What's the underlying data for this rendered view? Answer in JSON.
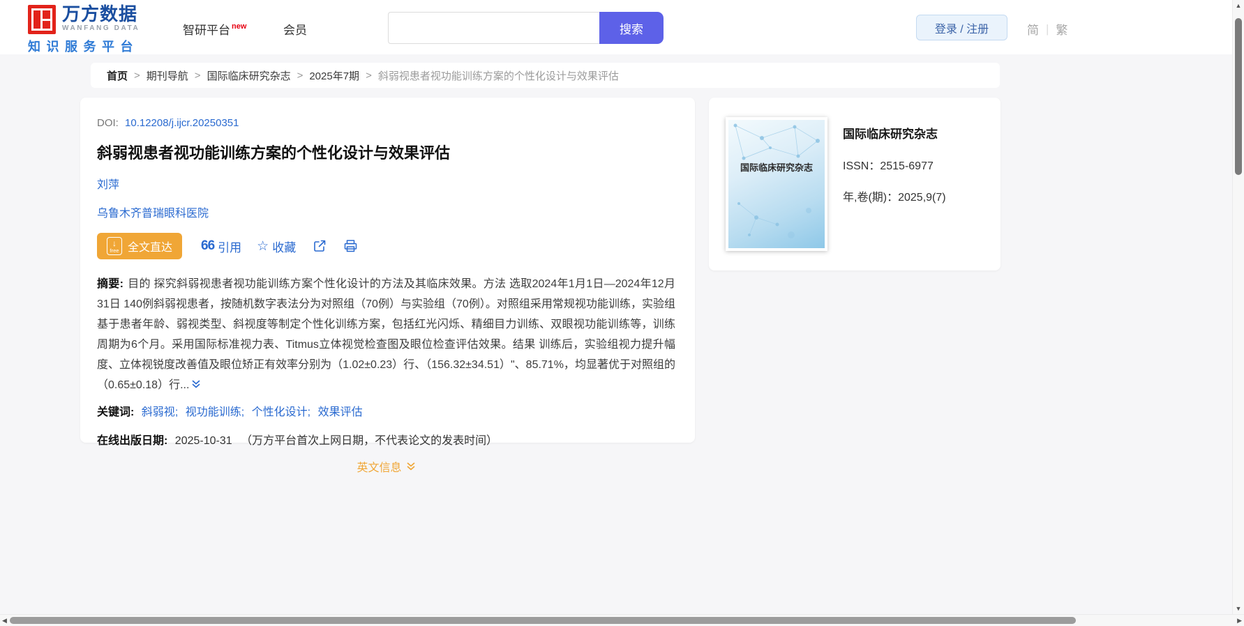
{
  "colors": {
    "brand_red": "#e2231a",
    "brand_blue": "#1b4fa0",
    "tagline_blue": "#2f7bd6",
    "link_blue": "#2a6ad0",
    "accent_orange": "#f0a636",
    "search_button_indigo": "#5d61e8"
  },
  "header": {
    "logo_title": "万方数据",
    "logo_subtitle": "WANFANG DATA",
    "logo_tagline": "知识服务平台",
    "nav": [
      {
        "label": "智研平台",
        "badge": "new"
      },
      {
        "label": "会员",
        "badge": ""
      }
    ],
    "search_button": "搜索",
    "login_label": "登录 / 注册",
    "lang_simplified": "简",
    "lang_traditional": "繁",
    "lang_divider": "|"
  },
  "breadcrumb": {
    "separator": ">",
    "items": [
      "首页",
      "期刊导航",
      "国际临床研究杂志",
      "2025年7期"
    ],
    "current": "斜弱视患者视功能训练方案的个性化设计与效果评估"
  },
  "article": {
    "doi_label": "DOI:",
    "doi": "10.12208/j.ijcr.20250351",
    "title": "斜弱视患者视功能训练方案的个性化设计与效果评估",
    "author": "刘萍",
    "affiliation": "乌鲁木齐普瑞眼科医院",
    "fulltext_label": "全文直达",
    "fulltext_free": "free",
    "fulltext_arrow": "↓",
    "cite_icon": "66",
    "cite_label": "引用",
    "favorite_icon": "☆",
    "favorite_label": "收藏",
    "abstract_label": "摘要:",
    "abstract_text": "目的 探究斜弱视患者视功能训练方案个性化设计的方法及其临床效果。方法 选取2024年1月1日—2024年12月31日 140例斜弱视患者，按随机数字表法分为对照组（70例）与实验组（70例）。对照组采用常规视功能训练，实验组基于患者年龄、弱视类型、斜视度等制定个性化训练方案，包括红光闪烁、精细目力训练、双眼视功能训练等，训练周期为6个月。采用国际标准视力表、Titmus立体视觉检查图及眼位检查评估效果。结果 训练后，实验组视力提升幅度、立体视锐度改善值及眼位矫正有效率分别为（1.02±0.23）行、（156.32±34.51）\"、85.71%，均显著优于对照组的（0.65±0.18）行...",
    "keyword_label": "关键词:",
    "keyword_separator": ";",
    "keywords": [
      "斜弱视",
      "视功能训练",
      "个性化设计",
      "效果评估"
    ],
    "online_date_label": "在线出版日期:",
    "online_date": "2025-10-31",
    "online_date_note": "（万方平台首次上网日期，不代表论文的发表时间）",
    "english_info_label": "英文信息"
  },
  "journal": {
    "cover_title": "国际临床研究杂志",
    "name": "国际临床研究杂志",
    "issn_label": "ISSN：",
    "issn": "2515-6977",
    "volume_label": "年,卷(期)：",
    "volume": "2025,9(7)"
  },
  "scrollbar": {
    "up_arrow": "▲",
    "down_arrow": "▼",
    "left_arrow": "◀",
    "right_arrow": "▶"
  }
}
